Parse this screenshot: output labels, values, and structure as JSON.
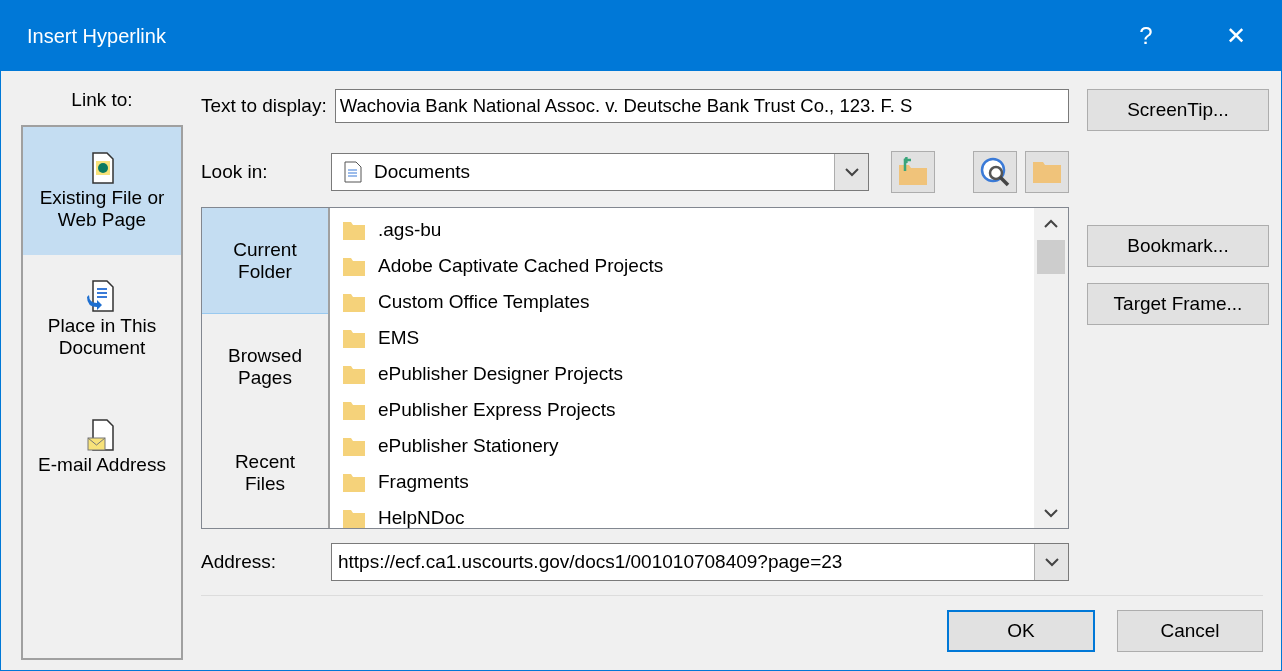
{
  "window": {
    "title": "Insert Hyperlink",
    "help": "?",
    "close": "✕"
  },
  "link_to": {
    "label": "Link to:",
    "items": [
      {
        "kind": "file",
        "label": "Existing File or Web Page",
        "selected": true
      },
      {
        "kind": "place",
        "label": "Place in This Document",
        "selected": false
      },
      {
        "kind": "email",
        "label": "E-mail Address",
        "selected": false
      }
    ]
  },
  "text_to_display": {
    "label": "Text to display:",
    "value": "Wachovia Bank National Assoc. v. Deutsche Bank Trust Co., 123. F. S"
  },
  "look_in": {
    "label": "Look in:",
    "value": "Documents"
  },
  "browse_nav": [
    {
      "label": "Current Folder",
      "selected": true
    },
    {
      "label": "Browsed Pages",
      "selected": false
    },
    {
      "label": "Recent Files",
      "selected": false
    }
  ],
  "files": [
    ".ags-bu",
    "Adobe Captivate Cached Projects",
    "Custom Office Templates",
    "EMS",
    "ePublisher Designer Projects",
    "ePublisher Express Projects",
    "ePublisher Stationery",
    "Fragments",
    "HelpNDoc"
  ],
  "address": {
    "label": "Address:",
    "value": "https://ecf.ca1.uscourts.gov/docs1/001010708409?page=23"
  },
  "side_buttons": [
    "ScreenTip...",
    "Bookmark...",
    "Target Frame..."
  ],
  "buttons": [
    {
      "label": "OK",
      "default": true
    },
    {
      "label": "Cancel",
      "default": false
    }
  ]
}
